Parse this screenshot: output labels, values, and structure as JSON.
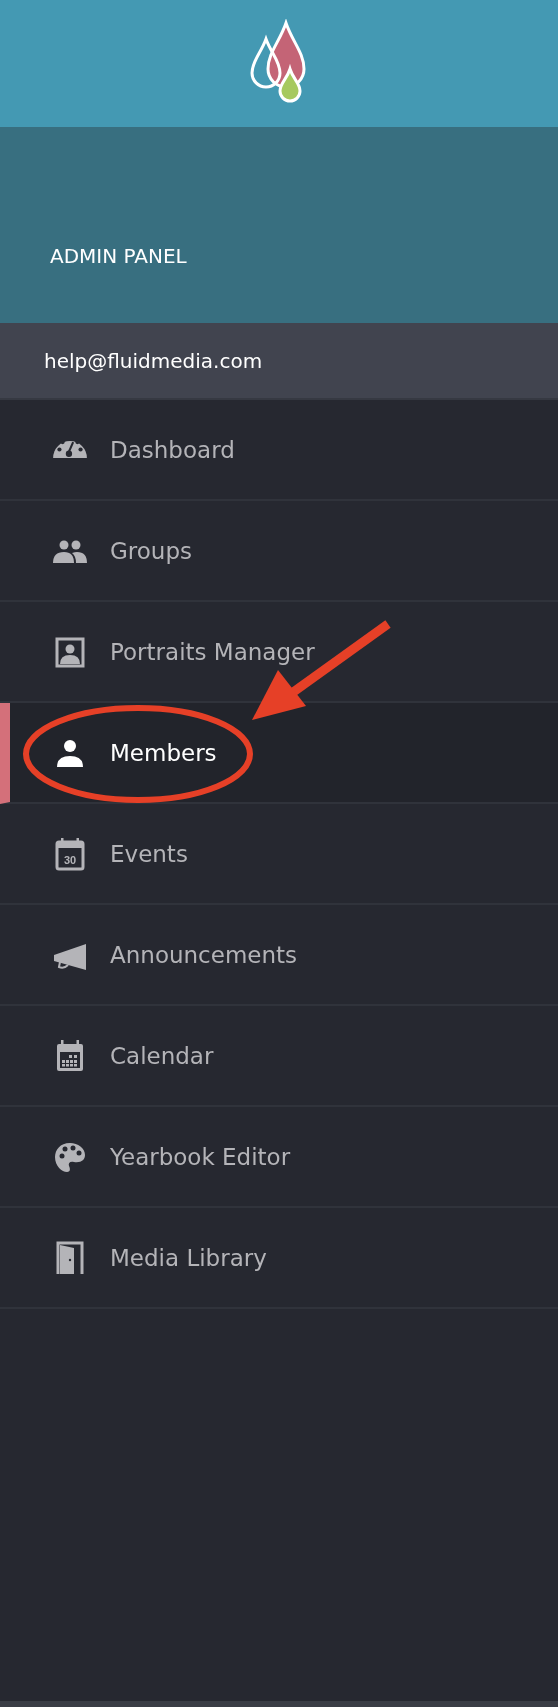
{
  "header": {
    "title": "ADMIN PANEL"
  },
  "account": {
    "email": "help@fluidmedia.com"
  },
  "menu": [
    {
      "label": "Dashboard",
      "kind": "gauge",
      "selected": false
    },
    {
      "label": "Groups",
      "kind": "people",
      "selected": false
    },
    {
      "label": "Portraits Manager",
      "kind": "portrait",
      "selected": false
    },
    {
      "label": "Members",
      "kind": "person",
      "selected": true
    },
    {
      "label": "Events",
      "kind": "date",
      "icon_text": "30",
      "selected": false
    },
    {
      "label": "Announcements",
      "kind": "megaphone",
      "selected": false
    },
    {
      "label": "Calendar",
      "kind": "calendar",
      "selected": false
    },
    {
      "label": "Yearbook Editor",
      "kind": "palette",
      "selected": false
    },
    {
      "label": "Media Library",
      "kind": "door",
      "selected": false
    }
  ],
  "annotation": {
    "kind": "circle-arrow"
  }
}
